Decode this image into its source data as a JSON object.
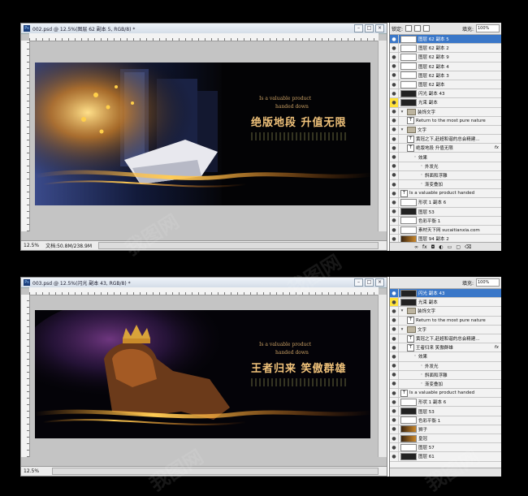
{
  "panels": [
    {
      "doc_title": "002.psd @ 12.5%(图层 62 副本 5, RGB/8) *",
      "status_zoom": "12.5%",
      "status_doc": "文档:50.8M/238.9M",
      "art": {
        "en1": "Is a valuable product",
        "en2": "handed down",
        "cn": "绝版地段  升值无限"
      },
      "layers_header": {
        "lock_label": "锁定:",
        "fill_label": "填充:",
        "fill_value": "100%"
      },
      "layers": [
        {
          "label": "图层 62 副本 5",
          "kind": "thumb",
          "selected": true
        },
        {
          "label": "图层 62 副本 2",
          "kind": "thumb"
        },
        {
          "label": "图层 62 副本 9",
          "kind": "thumb"
        },
        {
          "label": "图层 62 副本 4",
          "kind": "thumb"
        },
        {
          "label": "图层 62 副本 3",
          "kind": "thumb"
        },
        {
          "label": "图层 62 副本",
          "kind": "thumb"
        },
        {
          "label": "闪光 副本 43",
          "kind": "thumb-dark"
        },
        {
          "label": "光束 副本",
          "kind": "thumb-dark",
          "eye": "yellow"
        },
        {
          "label": "装饰文字",
          "kind": "folder"
        },
        {
          "label": "Return to the most pure nature",
          "kind": "text",
          "indent": 1
        },
        {
          "label": "文字",
          "kind": "folder"
        },
        {
          "label": "黄冠之下,赶超和谐的总会精建...",
          "kind": "text",
          "indent": 1
        },
        {
          "label": "绝版地段  升值无限",
          "kind": "text",
          "indent": 1,
          "fx": "fx"
        },
        {
          "label": "效果",
          "kind": "plain",
          "indent": 2
        },
        {
          "label": "外发光",
          "kind": "plain",
          "indent": 3
        },
        {
          "label": "斜面和浮雕",
          "kind": "plain",
          "indent": 3
        },
        {
          "label": "渐变叠加",
          "kind": "plain",
          "indent": 3
        },
        {
          "label": "Is a valuable product  handed",
          "kind": "text"
        },
        {
          "label": "形状 1 副本 6",
          "kind": "thumb"
        },
        {
          "label": "图层 53",
          "kind": "thumb-dark"
        },
        {
          "label": "色彩平衡 1",
          "kind": "thumb"
        },
        {
          "label": "素材天下网 sucaitianxia.com",
          "kind": "thumb"
        },
        {
          "label": "图层 94 副本 2",
          "kind": "thumb-art"
        }
      ]
    },
    {
      "doc_title": "003.psd @ 12.5%(闪光 副本 43, RGB/8) *",
      "status_zoom": "12.5%",
      "status_doc": "",
      "art": {
        "en1": "Is a valuable product",
        "en2": "handed down",
        "cn": "王者归来  笑傲群雄"
      },
      "layers_header": {
        "lock_label": "",
        "fill_label": "填充:",
        "fill_value": "100%"
      },
      "layers": [
        {
          "label": "闪光 副本 43",
          "kind": "thumb-dark",
          "selected": true
        },
        {
          "label": "光束 副本",
          "kind": "thumb-dark",
          "eye": "yellow"
        },
        {
          "label": "装饰文字",
          "kind": "folder"
        },
        {
          "label": "Return to the most pure nature",
          "kind": "text",
          "indent": 1
        },
        {
          "label": "文字",
          "kind": "folder"
        },
        {
          "label": "黄冠之下,赶超和谐的总会精建...",
          "kind": "text",
          "indent": 1
        },
        {
          "label": "王者归来  笑傲群雄",
          "kind": "text",
          "indent": 1,
          "fx": "fx"
        },
        {
          "label": "效果",
          "kind": "plain",
          "indent": 2
        },
        {
          "label": "外发光",
          "kind": "plain",
          "indent": 3
        },
        {
          "label": "斜面和浮雕",
          "kind": "plain",
          "indent": 3
        },
        {
          "label": "渐变叠加",
          "kind": "plain",
          "indent": 3
        },
        {
          "label": "Is a valuable product  handed",
          "kind": "text"
        },
        {
          "label": "形状 1 副本 6",
          "kind": "thumb"
        },
        {
          "label": "图层 53",
          "kind": "thumb-dark"
        },
        {
          "label": "色彩平衡 1",
          "kind": "thumb"
        },
        {
          "label": "狮子",
          "kind": "thumb-art"
        },
        {
          "label": "皇冠",
          "kind": "thumb-art"
        },
        {
          "label": "图层 57",
          "kind": "thumb"
        },
        {
          "label": "图层 61",
          "kind": "thumb-dark"
        }
      ]
    }
  ],
  "watermark": "我图网"
}
